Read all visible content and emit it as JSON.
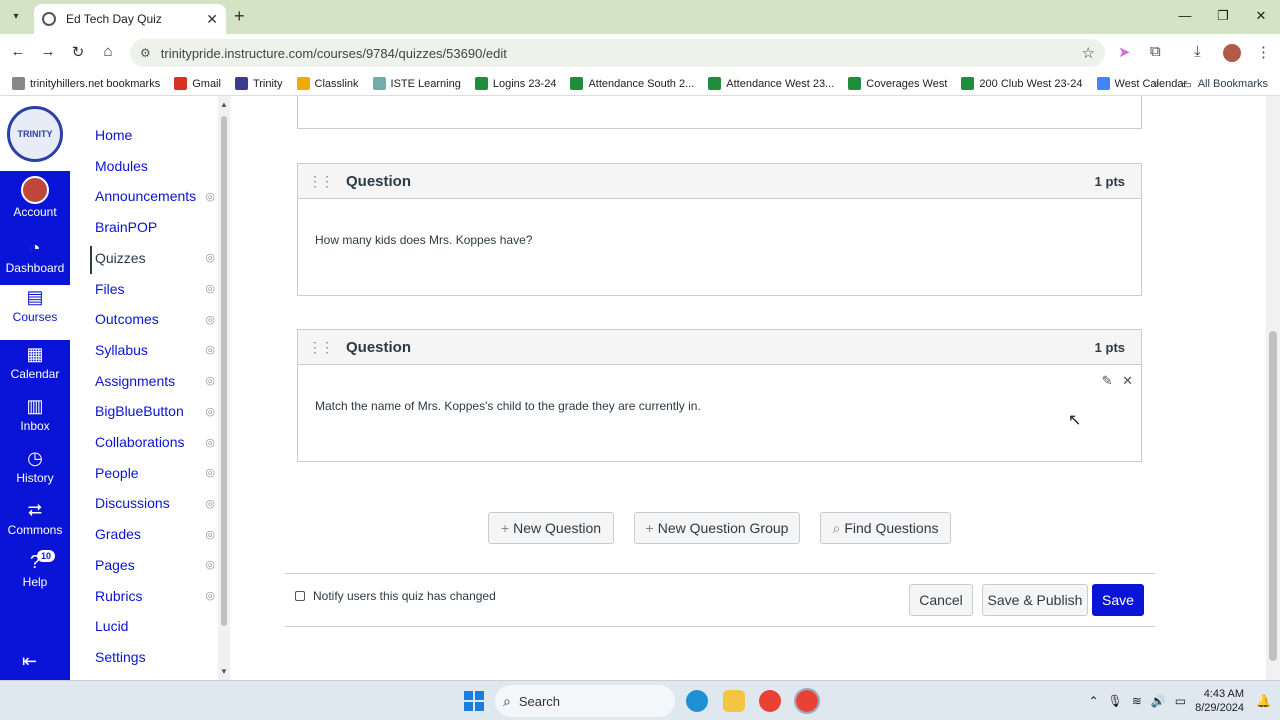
{
  "browser": {
    "tab_title": "Ed Tech Day Quiz",
    "url": "trinitypride.instructure.com/courses/9784/quizzes/53690/edit",
    "bookmarks": [
      {
        "label": "trinityhillers.net bookmarks",
        "color": "#888888"
      },
      {
        "label": "Gmail",
        "color": "#d93025"
      },
      {
        "label": "Trinity",
        "color": "#3b3b8f"
      },
      {
        "label": "Classlink",
        "color": "#f2a900"
      },
      {
        "label": "ISTE Learning",
        "color": "#7aa"
      },
      {
        "label": "Logins 23-24",
        "color": "#1e8e3e"
      },
      {
        "label": "Attendance South 2...",
        "color": "#1e8e3e"
      },
      {
        "label": "Attendance West 23...",
        "color": "#1e8e3e"
      },
      {
        "label": "Coverages West",
        "color": "#1e8e3e"
      },
      {
        "label": "200 Club West 23-24",
        "color": "#1e8e3e"
      },
      {
        "label": "West Calendar",
        "color": "#4285f4"
      }
    ],
    "all_bookmarks": "All Bookmarks"
  },
  "global_nav": {
    "items": [
      {
        "label": "Account",
        "icon": "avatar"
      },
      {
        "label": "Dashboard",
        "icon": "dashboard-icon"
      },
      {
        "label": "Courses",
        "icon": "book-icon"
      },
      {
        "label": "Calendar",
        "icon": "calendar-icon"
      },
      {
        "label": "Inbox",
        "icon": "inbox-icon"
      },
      {
        "label": "History",
        "icon": "clock-icon"
      },
      {
        "label": "Commons",
        "icon": "commons-icon"
      },
      {
        "label": "Help",
        "icon": "help-icon",
        "badge": "10"
      }
    ]
  },
  "course_nav": {
    "items": [
      {
        "label": "Home",
        "hidden": false
      },
      {
        "label": "Modules",
        "hidden": false
      },
      {
        "label": "Announcements",
        "hidden": true
      },
      {
        "label": "BrainPOP",
        "hidden": false
      },
      {
        "label": "Quizzes",
        "hidden": true,
        "active": true
      },
      {
        "label": "Files",
        "hidden": true
      },
      {
        "label": "Outcomes",
        "hidden": true
      },
      {
        "label": "Syllabus",
        "hidden": true
      },
      {
        "label": "Assignments",
        "hidden": true
      },
      {
        "label": "BigBlueButton",
        "hidden": true
      },
      {
        "label": "Collaborations",
        "hidden": true
      },
      {
        "label": "People",
        "hidden": true
      },
      {
        "label": "Discussions",
        "hidden": true
      },
      {
        "label": "Grades",
        "hidden": true
      },
      {
        "label": "Pages",
        "hidden": true
      },
      {
        "label": "Rubrics",
        "hidden": true
      },
      {
        "label": "Lucid",
        "hidden": false
      },
      {
        "label": "Settings",
        "hidden": false
      }
    ]
  },
  "questions": [
    {
      "title": "Question",
      "points": "1 pts",
      "text": "How many kids does Mrs. Koppes have?"
    },
    {
      "title": "Question",
      "points": "1 pts",
      "text": "Match the name of Mrs. Koppes's child to the grade they are currently in."
    }
  ],
  "actions": {
    "new_question": "New Question",
    "new_question_group": "New Question Group",
    "find_questions": "Find Questions",
    "notify_label": "Notify users this quiz has changed",
    "cancel": "Cancel",
    "save_publish": "Save & Publish",
    "save": "Save"
  },
  "taskbar": {
    "search_placeholder": "Search",
    "time": "4:43 AM",
    "date": "8/29/2024"
  },
  "colors": {
    "brand": "#0a14d6",
    "tabstrip": "#d3e3c4"
  }
}
